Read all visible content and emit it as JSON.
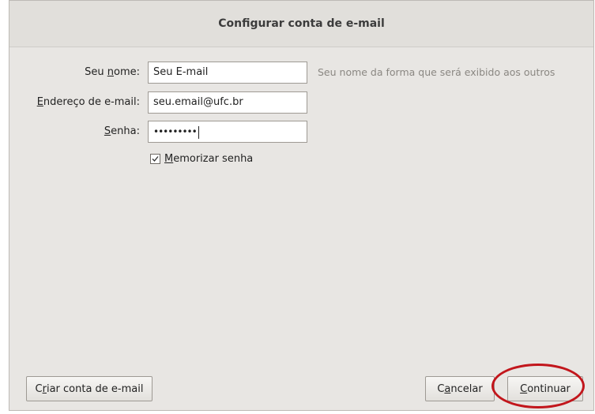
{
  "dialog": {
    "title": "Configurar conta de e-mail"
  },
  "form": {
    "name": {
      "label_pre": "Seu ",
      "label_accel": "n",
      "label_post": "ome:",
      "value": "Seu E-mail",
      "hint": "Seu nome da forma que será exibido aos outros"
    },
    "email": {
      "label_pre": "",
      "label_accel": "E",
      "label_post": "ndereço de e-mail:",
      "value": "seu.email@ufc.br"
    },
    "password": {
      "label_pre": "",
      "label_accel": "S",
      "label_post": "enha:",
      "masked_value": "•••••••••"
    },
    "remember": {
      "checked": true,
      "label_pre": "",
      "label_accel": "M",
      "label_post": "emorizar senha"
    }
  },
  "buttons": {
    "create_account": {
      "pre": "C",
      "accel": "r",
      "post": "iar conta de e-mail"
    },
    "cancel": {
      "pre": "C",
      "accel": "a",
      "post": "ncelar"
    },
    "continue": {
      "pre": "",
      "accel": "C",
      "post": "ontinuar"
    }
  },
  "colors": {
    "dialog_bg": "#e8e6e3",
    "highlight": "#c2161c"
  }
}
